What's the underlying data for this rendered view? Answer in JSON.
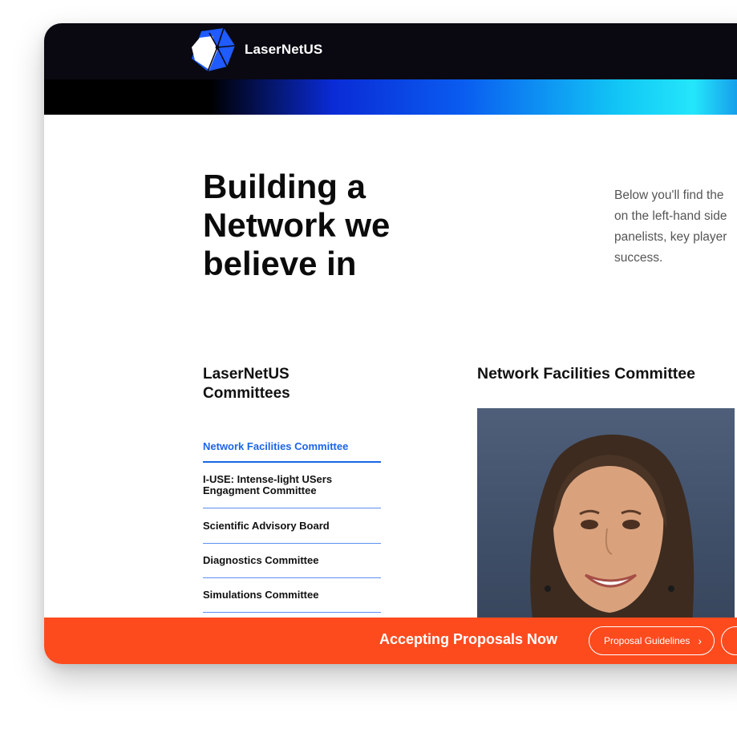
{
  "header": {
    "brand": "LaserNetUS",
    "logo_icon": "lasernetus-logo-icon",
    "colors": {
      "topbar": "#0a0912",
      "gradient_start": "#0a2bd6",
      "gradient_end": "#24e6fb"
    }
  },
  "hero": {
    "title": "Building a\nNetwork we\nbelieve in",
    "intro": "Below you'll find the\non the left-hand side\npanelists, key player\nsuccess."
  },
  "sidebar": {
    "heading": "LaserNetUS\nCommittees",
    "items": [
      {
        "label": "Network Facilities Committee",
        "active": true
      },
      {
        "label": "I-USE: Intense-light USers Engagment Committee",
        "active": false
      },
      {
        "label": "Scientific Advisory Board",
        "active": false
      },
      {
        "label": "Diagnostics Committee",
        "active": false
      },
      {
        "label": "Simulations Committee",
        "active": false
      }
    ],
    "colors": {
      "active": "#1a66e8",
      "divider": "#5e8ff0"
    }
  },
  "main": {
    "heading": "Network Facilities Committee",
    "portrait": "committee-member-portrait"
  },
  "banner": {
    "text": "Accepting Proposals Now",
    "buttons": [
      {
        "label": "Proposal Guidelines",
        "icon": "chevron-right-icon"
      },
      {
        "label": "",
        "icon": "chevron-right-icon"
      }
    ],
    "color": "#fd4b1e"
  }
}
